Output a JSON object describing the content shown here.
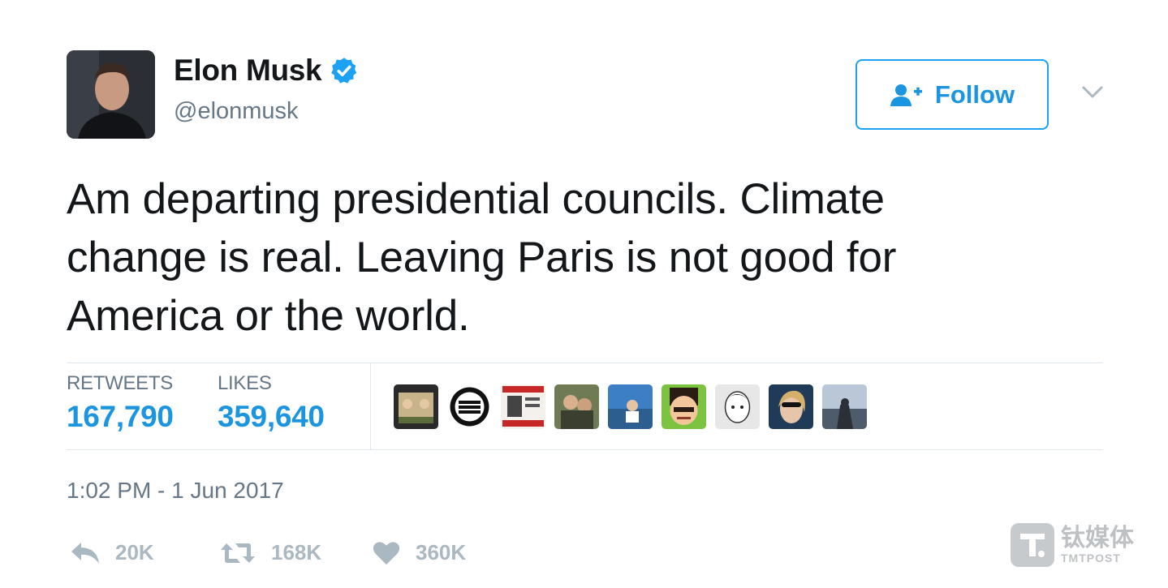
{
  "author": {
    "display_name": "Elon Musk",
    "handle": "@elonmusk",
    "verified": true
  },
  "follow_button": {
    "label": "Follow"
  },
  "tweet": {
    "text": "Am departing presidential councils. Climate\nchange is real. Leaving Paris is not good for\nAmerica or the world."
  },
  "stats": {
    "retweets_label": "RETWEETS",
    "retweets_value": "167,790",
    "likes_label": "LIKES",
    "likes_value": "359,640"
  },
  "likers_count_shown": 9,
  "timestamp": "1:02 PM - 1 Jun 2017",
  "actions": {
    "reply_count": "20K",
    "retweet_count": "168K",
    "like_count": "360K"
  },
  "watermark": {
    "cn": "钛媒体",
    "en": "TMTPOST"
  },
  "colors": {
    "accent": "#1da1f2",
    "link": "#1b95e0",
    "text": "#14171a",
    "muted": "#657786",
    "icon_muted": "#aab8c2",
    "divider": "#e1e8ed"
  }
}
